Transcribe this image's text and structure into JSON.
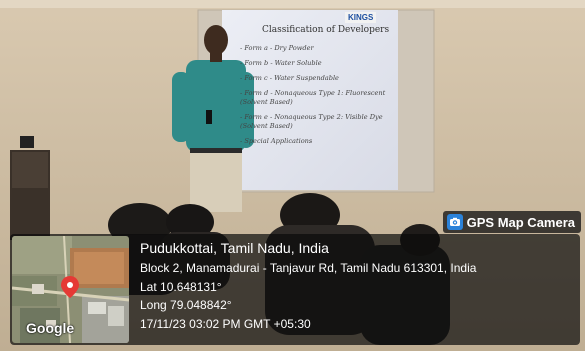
{
  "badge": {
    "label": "GPS Map Camera",
    "icon": "camera-icon"
  },
  "map": {
    "logo": "Google"
  },
  "location": {
    "city": "Pudukkottai, Tamil Nadu, India",
    "address": "Block 2, Manamadurai - Tanjavur Rd, Tamil Nadu 613301, India",
    "lat": "Lat 10.648131°",
    "long": "Long 79.048842°",
    "datetime": "17/11/23 03:02 PM GMT +05:30"
  },
  "slide": {
    "title": "Classification of Developers",
    "brand": "KINGS",
    "bullets": [
      "- Form a - Dry Powder",
      "- Form b - Water Soluble",
      "- Form c - Water Suspendable",
      "- Form d - Nonaqueous Type 1: Fluorescent",
      "(Solvent Based)",
      "- Form e - Nonaqueous Type 2: Visible Dye",
      "(Solvent Based)",
      "- Special Applications"
    ]
  },
  "colors": {
    "wall": "#cdbfa8",
    "screen": "#e6e8f1",
    "panel": "#1a1a1a",
    "accent": "#2b82d9"
  }
}
